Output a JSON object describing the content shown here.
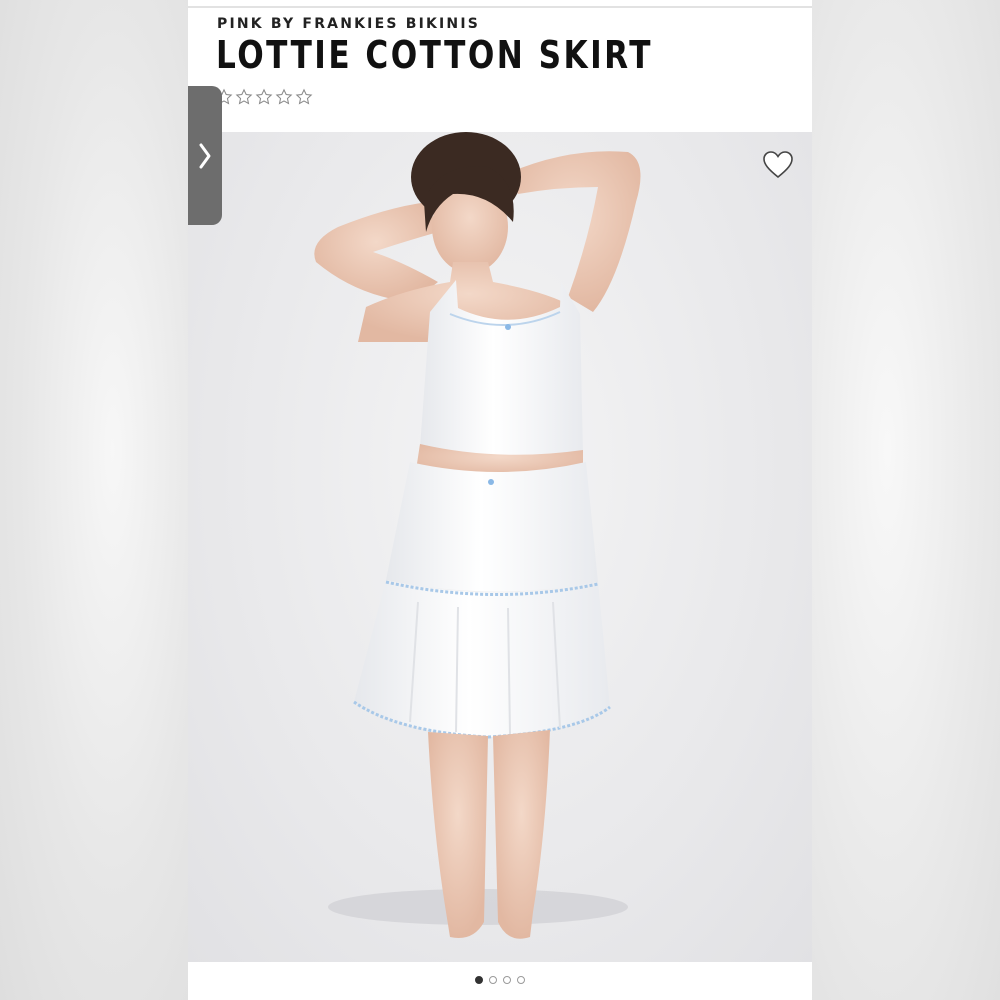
{
  "product": {
    "brand": "PINK BY FRANKIES BIKINIS",
    "title": "LOTTIE COTTON SKIRT",
    "rating_stars": 5,
    "rating_value": 0
  },
  "icons": {
    "nav": "chevron-right-icon",
    "favorite": "heart-outline-icon",
    "rating": "star-outline-icon"
  },
  "gallery": {
    "image_count": 4,
    "active_index": 0
  },
  "colors": {
    "title": "#111111",
    "tab": "#6d6d6d",
    "lace_trim": "#a8c8e8"
  }
}
